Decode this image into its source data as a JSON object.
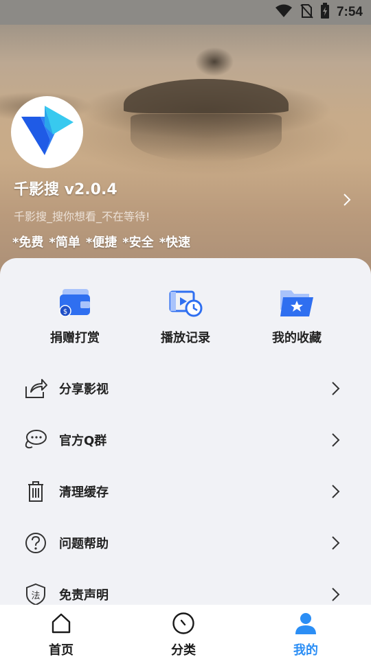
{
  "status_bar": {
    "time": "7:54",
    "icons": [
      "wifi-icon",
      "no-sim-icon",
      "battery-icon"
    ]
  },
  "profile": {
    "app_name": "千影搜 v2.0.4",
    "slogan": "千影搜_搜你想看_不在等待!",
    "tags": [
      "*免费",
      "*简单",
      "*便捷",
      "*安全",
      "*快速"
    ]
  },
  "quick_actions": [
    {
      "label": "捐赠打赏",
      "icon": "wallet-icon"
    },
    {
      "label": "播放记录",
      "icon": "play-history-icon"
    },
    {
      "label": "我的收藏",
      "icon": "favorites-folder-icon"
    }
  ],
  "menu": [
    {
      "label": "分享影视",
      "icon": "share-icon"
    },
    {
      "label": "官方Q群",
      "icon": "chat-icon"
    },
    {
      "label": "清理缓存",
      "icon": "trash-icon"
    },
    {
      "label": "问题帮助",
      "icon": "help-icon"
    },
    {
      "label": "免责声明",
      "icon": "law-shield-icon"
    }
  ],
  "bottom_nav": [
    {
      "label": "首页",
      "icon": "home-icon",
      "active": false
    },
    {
      "label": "分类",
      "icon": "compass-icon",
      "active": false
    },
    {
      "label": "我的",
      "icon": "user-icon",
      "active": true
    }
  ],
  "colors": {
    "accent": "#2b8ef5",
    "panel_bg": "#f1f2f6",
    "icon_blue": "#3a6ff2"
  }
}
